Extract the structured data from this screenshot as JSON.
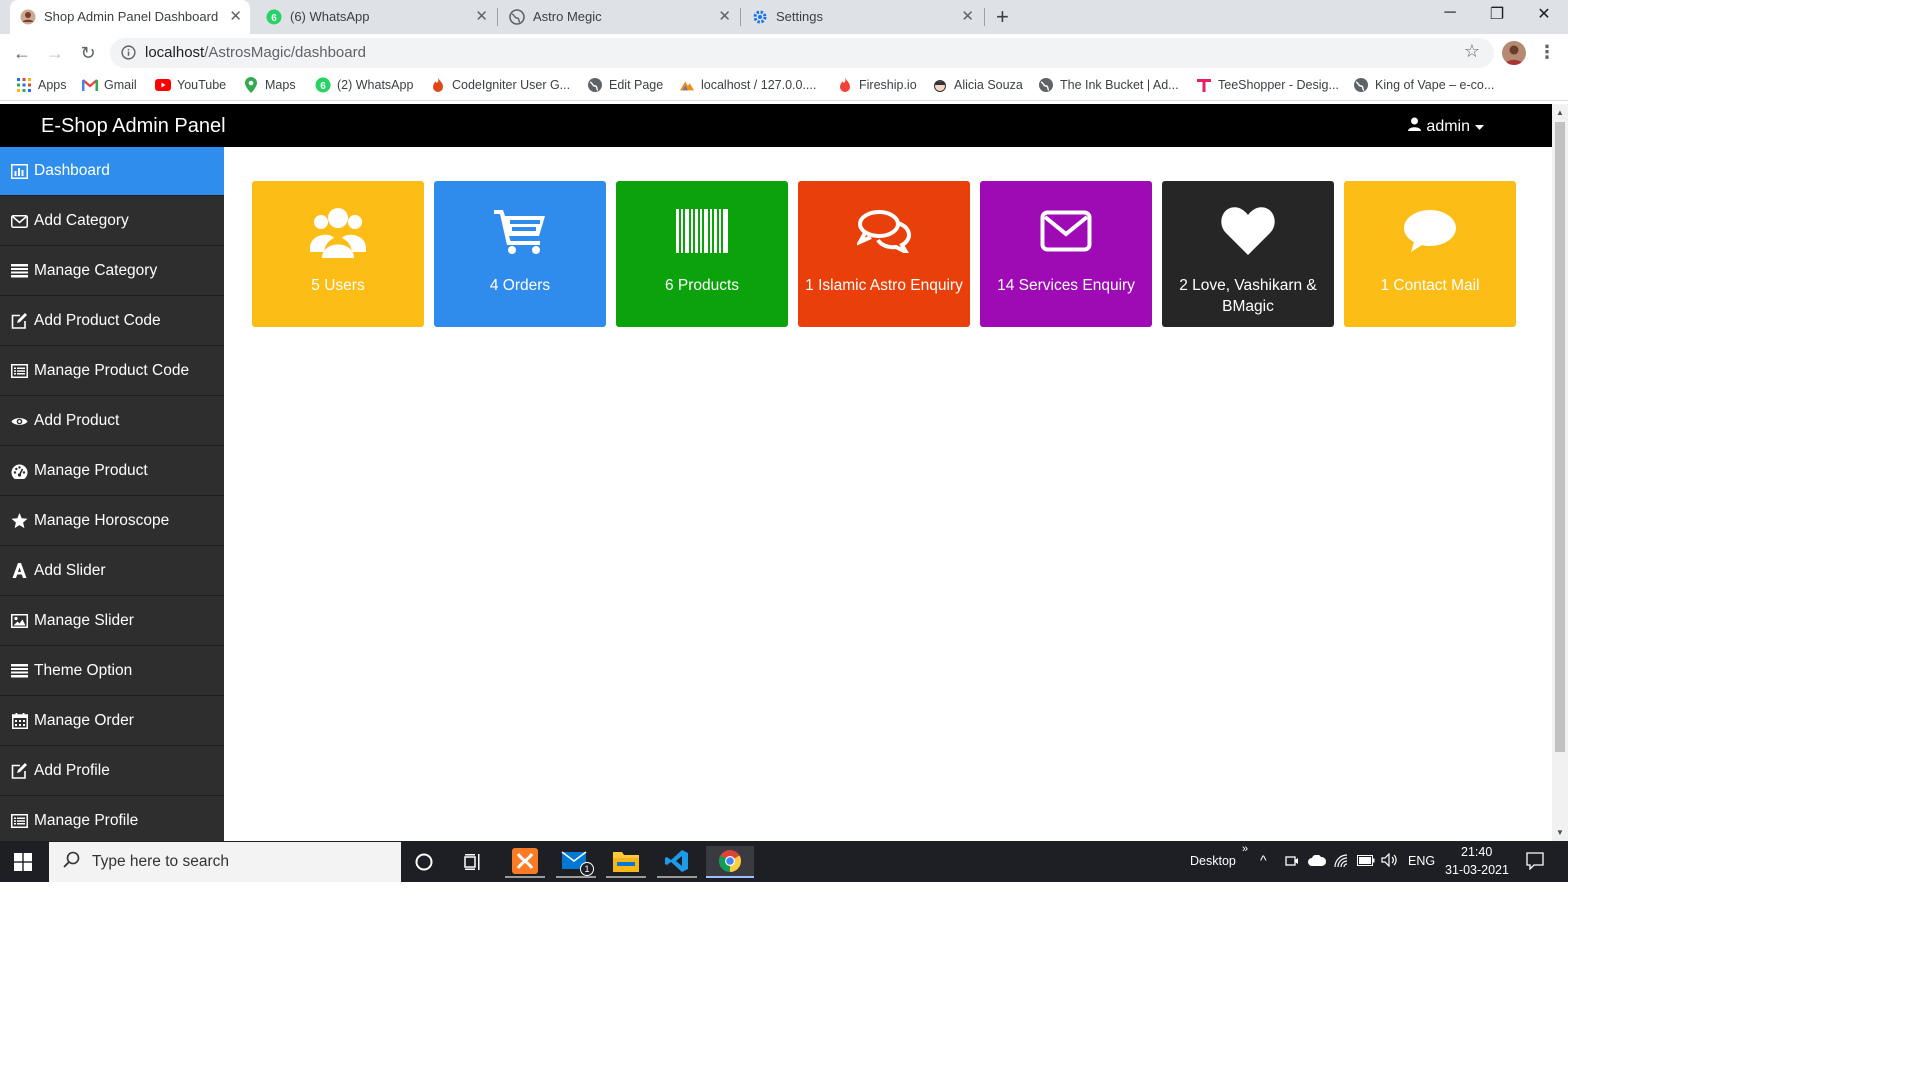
{
  "browser": {
    "tabs": [
      {
        "title": "Shop Admin Panel Dashboard",
        "active": true,
        "icon": "profile-favicon"
      },
      {
        "title": "(6) WhatsApp",
        "active": false,
        "icon": "whatsapp-icon"
      },
      {
        "title": "Astro Megic",
        "active": false,
        "icon": "globe-icon"
      },
      {
        "title": "Settings",
        "active": false,
        "icon": "gear-icon"
      }
    ],
    "url_host": "localhost",
    "url_path": "/AstrosMagic/dashboard",
    "bookmarks": [
      {
        "label": "Apps",
        "icon": "apps-grid-icon"
      },
      {
        "label": "Gmail",
        "icon": "gmail-icon"
      },
      {
        "label": "YouTube",
        "icon": "youtube-icon"
      },
      {
        "label": "Maps",
        "icon": "maps-pin-icon"
      },
      {
        "label": "(2) WhatsApp",
        "icon": "whatsapp-icon"
      },
      {
        "label": "CodeIgniter User G...",
        "icon": "codeigniter-flame-icon"
      },
      {
        "label": "Edit Page",
        "icon": "globe-icon"
      },
      {
        "label": "localhost / 127.0.0....",
        "icon": "phpmyadmin-icon"
      },
      {
        "label": "Fireship.io",
        "icon": "fire-icon"
      },
      {
        "label": "Alicia Souza",
        "icon": "face-icon"
      },
      {
        "label": "The Ink Bucket | Ad...",
        "icon": "globe-icon"
      },
      {
        "label": "TeeShopper - Desig...",
        "icon": "tee-icon"
      },
      {
        "label": "King of Vape – e-co...",
        "icon": "globe-icon"
      }
    ]
  },
  "app": {
    "brand": "E-Shop Admin Panel",
    "user": "admin"
  },
  "sidebar": {
    "items": [
      {
        "label": "Dashboard",
        "icon": "bar-chart-icon",
        "active": true
      },
      {
        "label": "Add Category",
        "icon": "envelope-icon"
      },
      {
        "label": "Manage Category",
        "icon": "list-icon"
      },
      {
        "label": "Add Product Code",
        "icon": "edit-icon"
      },
      {
        "label": "Manage Product Code",
        "icon": "list-alt-icon"
      },
      {
        "label": "Add Product",
        "icon": "eye-icon"
      },
      {
        "label": "Manage Product",
        "icon": "dashboard-gauge-icon"
      },
      {
        "label": "Manage Horoscope",
        "icon": "star-icon"
      },
      {
        "label": "Add Slider",
        "icon": "font-icon"
      },
      {
        "label": "Manage Slider",
        "icon": "picture-icon"
      },
      {
        "label": "Theme Option",
        "icon": "list-icon"
      },
      {
        "label": "Manage Order",
        "icon": "calendar-icon"
      },
      {
        "label": "Add Profile",
        "icon": "edit-icon"
      },
      {
        "label": "Manage Profile",
        "icon": "list-alt-icon"
      }
    ]
  },
  "tiles": [
    {
      "label": "5 Users",
      "icon": "users-icon",
      "color": "#fbbd16"
    },
    {
      "label": "4 Orders",
      "icon": "cart-icon",
      "color": "#2f8ced"
    },
    {
      "label": "6 Products",
      "icon": "barcode-icon",
      "color": "#0ca20c"
    },
    {
      "label": "1 Islamic Astro Enquiry",
      "icon": "chat-bubbles-icon",
      "color": "#e93f0b"
    },
    {
      "label": "14 Services Enquiry",
      "icon": "envelope-icon",
      "color": "#9e0ab3"
    },
    {
      "label": "2 Love, Vashikarn & BMagic",
      "icon": "heart-icon",
      "color": "#262626"
    },
    {
      "label": "1 Contact Mail",
      "icon": "comment-icon",
      "color": "#fbbd16"
    }
  ],
  "taskbar": {
    "search_placeholder": "Type here to search",
    "desktop_label": "Desktop",
    "language": "ENG",
    "time": "21:40",
    "date": "31-03-2021",
    "mail_badge": "1"
  }
}
